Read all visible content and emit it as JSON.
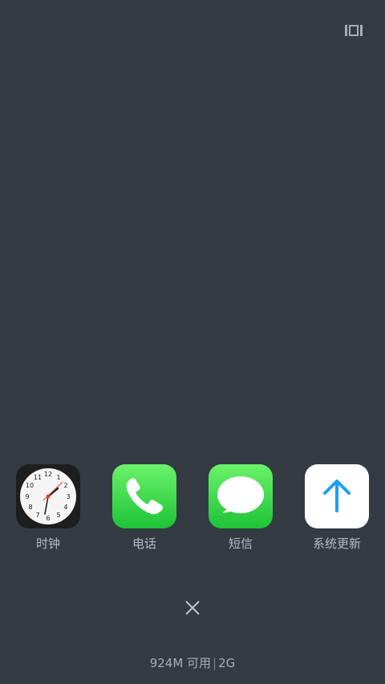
{
  "apps": [
    {
      "label": "时钟",
      "icon": "clock-icon"
    },
    {
      "label": "电话",
      "icon": "phone-icon"
    },
    {
      "label": "短信",
      "icon": "messages-icon"
    },
    {
      "label": "系统更新",
      "icon": "system-update-icon"
    }
  ],
  "clock_numbers": [
    "12",
    "1",
    "2",
    "3",
    "4",
    "5",
    "6",
    "7",
    "8",
    "9",
    "10",
    "11"
  ],
  "memory": {
    "available": "924M 可用",
    "total": "2G"
  },
  "colors": {
    "background": "#353b43",
    "phone_green": "#2fd34a",
    "update_blue": "#1aa0f5"
  }
}
